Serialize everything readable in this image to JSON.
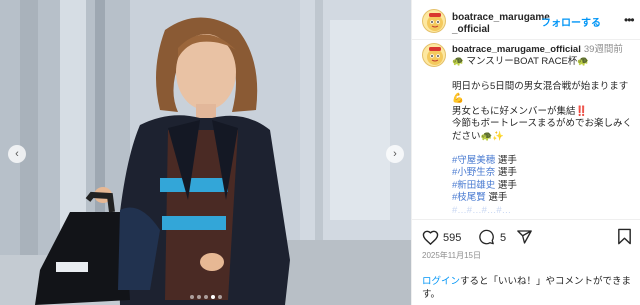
{
  "post": {
    "username": "boatrace_marugame_official",
    "username_line1": "boatrace_marugame",
    "username_line2": "_official",
    "follow_label": "フォローする",
    "more_label": "•••",
    "caption_user": "boatrace_marugame_official",
    "caption_time": "39週間前",
    "caption_line1": "🐢 マンスリーBOAT RACE杯🐢",
    "caption_line2": "明日から5日間の男女混合戦が始まります💪",
    "caption_line3": "男女ともに好メンバーが集結‼️",
    "caption_line4": "今節もボートレースまるがめでお楽しみください🐢✨",
    "hashtags": [
      "#守屋美穂",
      "#小野生奈",
      "#新田雄史",
      "#枝尾賢"
    ],
    "hashtag_suffix": " 選手",
    "faded_text": "#…#…#…#…",
    "like_count": "595",
    "comment_count": "5",
    "post_date": "2025年11月15日",
    "login_link": "ログイン",
    "login_text": "すると「いいね！」やコメントができます。"
  },
  "media": {
    "prev_icon": "‹",
    "next_icon": "›",
    "carousel_index": 3,
    "carousel_total": 5
  },
  "colors": {
    "accent": "#0095f6",
    "hashtag": "#00376b",
    "like_red": "#ed4956"
  }
}
